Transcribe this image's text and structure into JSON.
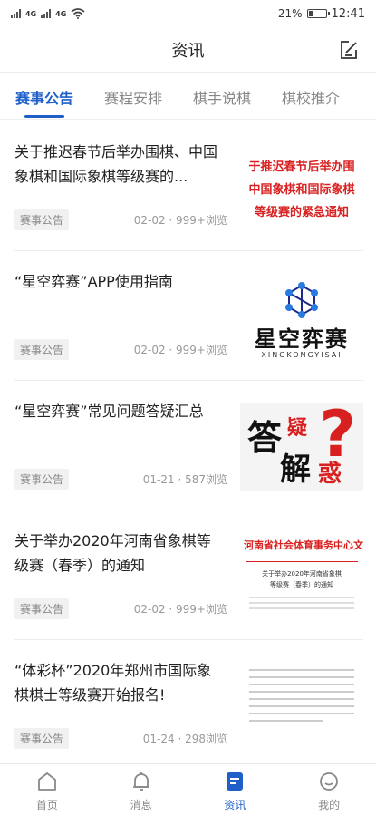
{
  "status_bar": {
    "time": "12:41",
    "battery": "21%",
    "network_1": "4G",
    "network_2": "4G",
    "battery_level": 0.21
  },
  "header": {
    "title": "资讯"
  },
  "tabs": [
    {
      "label": "赛事公告",
      "active": true
    },
    {
      "label": "赛程安排",
      "active": false
    },
    {
      "label": "棋手说棋",
      "active": false
    },
    {
      "label": "棋校推介",
      "active": false
    }
  ],
  "items": [
    {
      "title": "关于推迟春节后举办围棋、中国象棋和国际象棋等级赛的...",
      "tag": "赛事公告",
      "meta": "02-02 · 999+浏览",
      "thumb": {
        "line1": "于推迟春节后举办围",
        "line2": "中国象棋和国际象棋",
        "line3": "等级赛的紧急通知"
      }
    },
    {
      "title": "“星空弈赛”APP使用指南",
      "tag": "赛事公告",
      "meta": "02-02 · 999+浏览",
      "thumb": {
        "brand": "星空弈赛",
        "brand_en": "XINGKONGYISAI"
      }
    },
    {
      "title": "“星空弈赛”常见问题答疑汇总",
      "tag": "赛事公告",
      "meta": "01-21 · 587浏览",
      "thumb": {
        "c1": "答",
        "c2": "疑",
        "c3": "解",
        "c4": "惑"
      }
    },
    {
      "title": "关于举办2020年河南省象棋等级赛（春季）的通知",
      "tag": "赛事公告",
      "meta": "02-02 · 999+浏览",
      "thumb": {
        "header": "河南省社会体育事务中心文件",
        "doc_title_1": "关于举办2020年河南省象棋",
        "doc_title_2": "等级赛（春季）的通知"
      }
    },
    {
      "title": "“体彩杯”2020年郑州市国际象棋棋士等级赛开始报名!",
      "tag": "赛事公告",
      "meta": "01-24 · 298浏览"
    }
  ],
  "bottom_nav": [
    {
      "label": "首页",
      "icon": "home-icon",
      "active": false
    },
    {
      "label": "消息",
      "icon": "bell-icon",
      "active": false
    },
    {
      "label": "资讯",
      "icon": "news-icon",
      "active": true
    },
    {
      "label": "我的",
      "icon": "profile-icon",
      "active": false
    }
  ],
  "colors": {
    "accent": "#1f5fc8",
    "thumb_red": "#d92020",
    "tag_bg": "#f1f1f1"
  }
}
